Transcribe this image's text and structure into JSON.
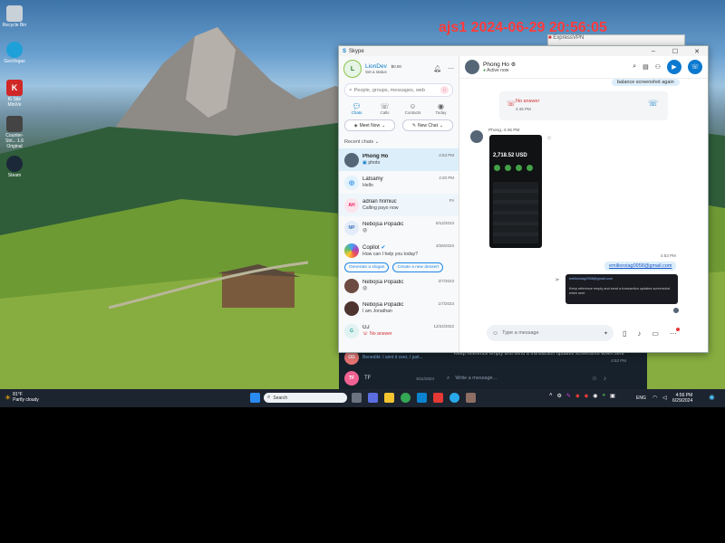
{
  "watermark": "ajs1 2024-06-29 20:56:05",
  "desktop_icons": [
    {
      "label": "Recycle Bin",
      "icon": "recycle-bin-icon",
      "color": "#c8d0d8"
    },
    {
      "label": "GeoVegas",
      "icon": "geovegas-icon",
      "color": "#1ea0d8"
    },
    {
      "label": "Ki Site MiniVe",
      "icon": "ki-app-icon",
      "color": "#d02828"
    },
    {
      "label": "Counter-Stri... 1.6 Original",
      "icon": "counter-strike-icon",
      "color": "#444444"
    },
    {
      "label": "Steam",
      "icon": "steam-icon",
      "color": "#1b2838"
    }
  ],
  "bg_window_title": "ExpressVPN",
  "skype": {
    "title": "Skype",
    "profile": {
      "name": "LionDev",
      "balance": "$0.00",
      "status": "Set a status",
      "initials": "L"
    },
    "search_placeholder": "People, groups, messages, web",
    "nav": [
      {
        "label": "Chats",
        "icon": "chat-icon"
      },
      {
        "label": "Calls",
        "icon": "calls-icon"
      },
      {
        "label": "Contacts",
        "icon": "contacts-icon"
      },
      {
        "label": "Today",
        "icon": "today-icon"
      }
    ],
    "meet_now": "Meet Now",
    "new_chat": "New Chat",
    "recent_label": "Recent chats",
    "chats": [
      {
        "name": "Phong Ho",
        "preview": "photo",
        "time": "4:53 PM",
        "initials": "",
        "color": "#556677",
        "selected": true
      },
      {
        "name": "Latsamy",
        "preview": "Hello",
        "time": "4:20 PM",
        "initials": "",
        "color": "#1e88e5",
        "selected": false
      },
      {
        "name": "adrian hrimiuc",
        "preview": "Calling payo now",
        "time": "Fri",
        "initials": "AH",
        "color": "#f06292",
        "selected": false
      },
      {
        "name": "Nebojsa Popadic",
        "preview": "",
        "time": "5/12/2023",
        "initials": "NP",
        "color": "#5c8fd6",
        "selected": false
      },
      {
        "name": "Copilot",
        "preview": "How can I help you today?",
        "time": "3/28/2023",
        "initials": "",
        "color": "#7e57c2",
        "selected": false
      },
      {
        "name": "Nebojsa Popadic",
        "preview": "",
        "time": "2/7/2023",
        "initials": "",
        "color": "#6d4c41",
        "selected": false
      },
      {
        "name": "Nebojsa Popadic",
        "preview": "I am Jonathan",
        "time": "1/7/2023",
        "initials": "",
        "color": "#4e342e",
        "selected": false
      },
      {
        "name": "GJ",
        "preview": "No answer",
        "time": "12/22/2022",
        "initials": "G",
        "color": "#26a69a",
        "selected": false
      }
    ],
    "copilot_actions": [
      "Generate a slogan",
      "Create a new dessert"
    ],
    "contact": {
      "name": "Phong Ho",
      "status": "Active now"
    },
    "messages": {
      "top_bubble": "balance screenshot again",
      "missed_call": "No answer",
      "missed_time": "4:46 PM",
      "photo_sender": "Phong, 4:46 PM",
      "photo_balance": "2,718.52 USD",
      "out_time": "4:53 PM",
      "email": "emilioroiag0958@gmail.com",
      "quote_text": "Keep reference empty and send a transaction updates screenshot when sent"
    },
    "compose_placeholder": "Type a message"
  },
  "telegram_bg": {
    "row1_text": "Keep reference empty and send a transaction updates screenshot when sent",
    "row1_from": "Benedikt: I sent it over, I just...",
    "row1_time": "4:52 PM",
    "row1_initials": "OD",
    "row2_name": "TF",
    "row2_time": "5/11/2024",
    "row2_initials": "TF",
    "compose": "Write a message..."
  },
  "taskbar": {
    "weather_temp": "81°F",
    "weather_desc": "Partly cloudy",
    "search_placeholder": "Search",
    "lang": "ENG",
    "time": "4:56 PM",
    "date": "6/29/2024"
  }
}
